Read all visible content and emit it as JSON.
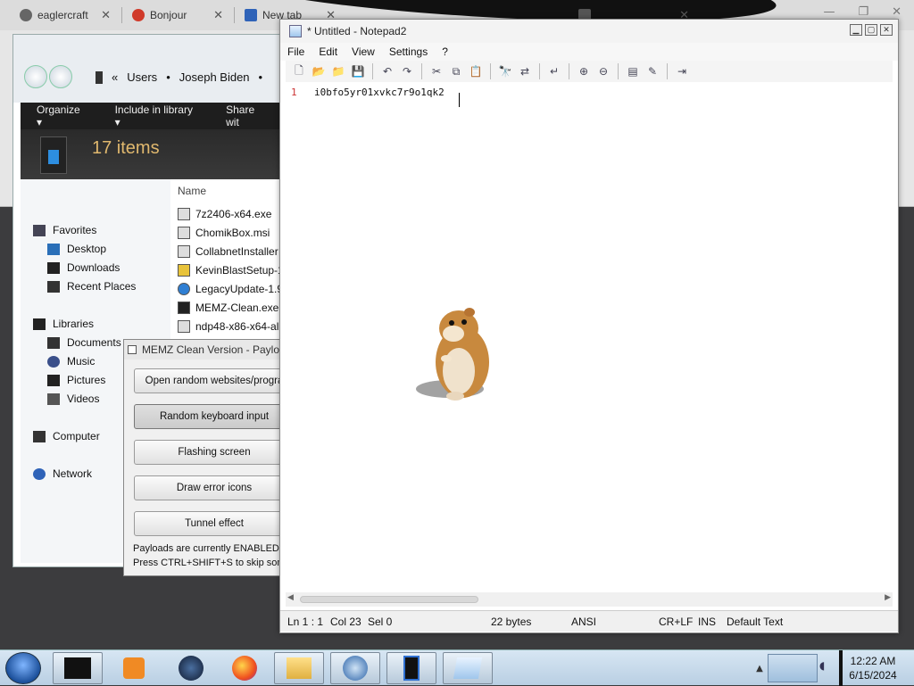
{
  "browser": {
    "tabs": [
      {
        "label": "eaglercraft",
        "close": "✕",
        "favicon_color": "#666666"
      },
      {
        "label": "Bonjour",
        "close": "✕",
        "favicon_color": "#d03a2a"
      },
      {
        "label": "New tab",
        "close": "✕",
        "favicon_color": "#2f63b8"
      },
      {
        "label": "",
        "close": "✕",
        "favicon_color": "#555555"
      }
    ],
    "window_controls": [
      "—",
      "❐",
      "✕"
    ]
  },
  "explorer": {
    "breadcrumb": [
      "«",
      "Users",
      "•",
      "Joseph Biden",
      "•"
    ],
    "commands": [
      "Organize ▾",
      "Include in library ▾",
      "Share wit"
    ],
    "items_count": "17 items",
    "column_header": "Name",
    "nav": [
      {
        "label": "Favorites",
        "icon": "star-icon"
      },
      {
        "label": "Desktop",
        "icon": "desktop-icon"
      },
      {
        "label": "Downloads",
        "icon": "downloads-icon"
      },
      {
        "label": "Recent Places",
        "icon": "recent-places-icon"
      },
      {
        "label": "Libraries",
        "icon": "libraries-icon"
      },
      {
        "label": "Documents",
        "icon": "documents-icon"
      },
      {
        "label": "Music",
        "icon": "music-icon"
      },
      {
        "label": "Pictures",
        "icon": "pictures-icon"
      },
      {
        "label": "Videos",
        "icon": "videos-icon"
      },
      {
        "label": "Computer",
        "icon": "computer-icon"
      },
      {
        "label": "Network",
        "icon": "network-icon"
      }
    ],
    "files": [
      "7z2406-x64.exe",
      "ChomikBox.msi",
      "CollabnetInstaller",
      "KevinBlastSetup-1",
      "LegacyUpdate-1.9",
      "MEMZ-Clean.exe",
      "ndp48-x86-x64-al"
    ]
  },
  "memz": {
    "title": "MEMZ Clean Version - Paylo",
    "buttons": [
      "Open random websites/progra",
      "Random keyboard input",
      "Flashing screen",
      "Draw error icons",
      "Tunnel effect"
    ],
    "status_1": "Payloads are currently ENABLED.",
    "status_2": "Press CTRL+SHIFT+S to skip som"
  },
  "notepad": {
    "title": "* Untitled - Notepad2",
    "menu": [
      "File",
      "Edit",
      "View",
      "Settings",
      "?"
    ],
    "line_number": "1",
    "text": "i0bfo5yr01xvkc7r9o1qk2",
    "status": {
      "position": "Ln 1 : 1",
      "col": "Col 23",
      "sel": "Sel 0",
      "size": "22 bytes",
      "encoding": "ANSI",
      "eol": "CR+LF",
      "mode": "INS",
      "scheme": "Default Text"
    }
  },
  "taskbar": {
    "time": "12:22 AM",
    "date": "6/15/2024"
  }
}
